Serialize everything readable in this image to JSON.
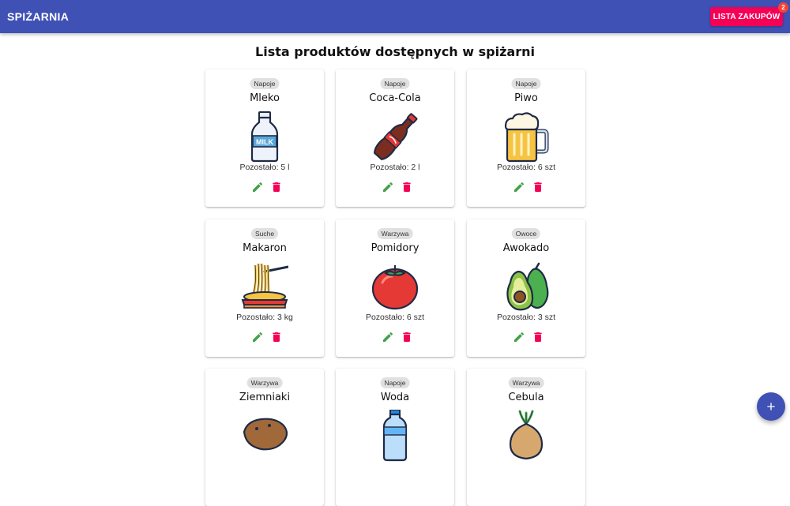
{
  "appbar": {
    "title": "SPIŻARNIA",
    "shopping_list_label": "LISTA ZAKUPÓW",
    "shopping_list_count": "2",
    "color": "#3f51b5",
    "accent": "#f50057"
  },
  "main": {
    "heading": "Lista produktów dostępnych w spiżarni"
  },
  "products": [
    {
      "category": "Napoje",
      "name": "Mleko",
      "remaining": "Pozostało: 5 l",
      "icon": "milk-bottle-icon"
    },
    {
      "category": "Napoje",
      "name": "Coca-Cola",
      "remaining": "Pozostało: 2 l",
      "icon": "cola-bottle-icon"
    },
    {
      "category": "Napoje",
      "name": "Piwo",
      "remaining": "Pozostało: 6 szt",
      "icon": "beer-mug-icon"
    },
    {
      "category": "Suche",
      "name": "Makaron",
      "remaining": "Pozostało: 3 kg",
      "icon": "pasta-bowl-icon"
    },
    {
      "category": "Warzywa",
      "name": "Pomidory",
      "remaining": "Pozostało: 6 szt",
      "icon": "tomato-icon"
    },
    {
      "category": "Owoce",
      "name": "Awokado",
      "remaining": "Pozostało: 3 szt",
      "icon": "avocado-icon"
    },
    {
      "category": "Warzywa",
      "name": "Ziemniaki",
      "remaining": "",
      "icon": "potato-icon"
    },
    {
      "category": "Napoje",
      "name": "Woda",
      "remaining": "",
      "icon": "water-bottle-icon"
    },
    {
      "category": "Warzywa",
      "name": "Cebula",
      "remaining": "",
      "icon": "onion-icon"
    }
  ],
  "icons": {
    "edit": "pencil-icon",
    "delete": "trash-icon",
    "add": "plus-icon",
    "edit_color": "#43a047",
    "delete_color": "#f50057"
  }
}
